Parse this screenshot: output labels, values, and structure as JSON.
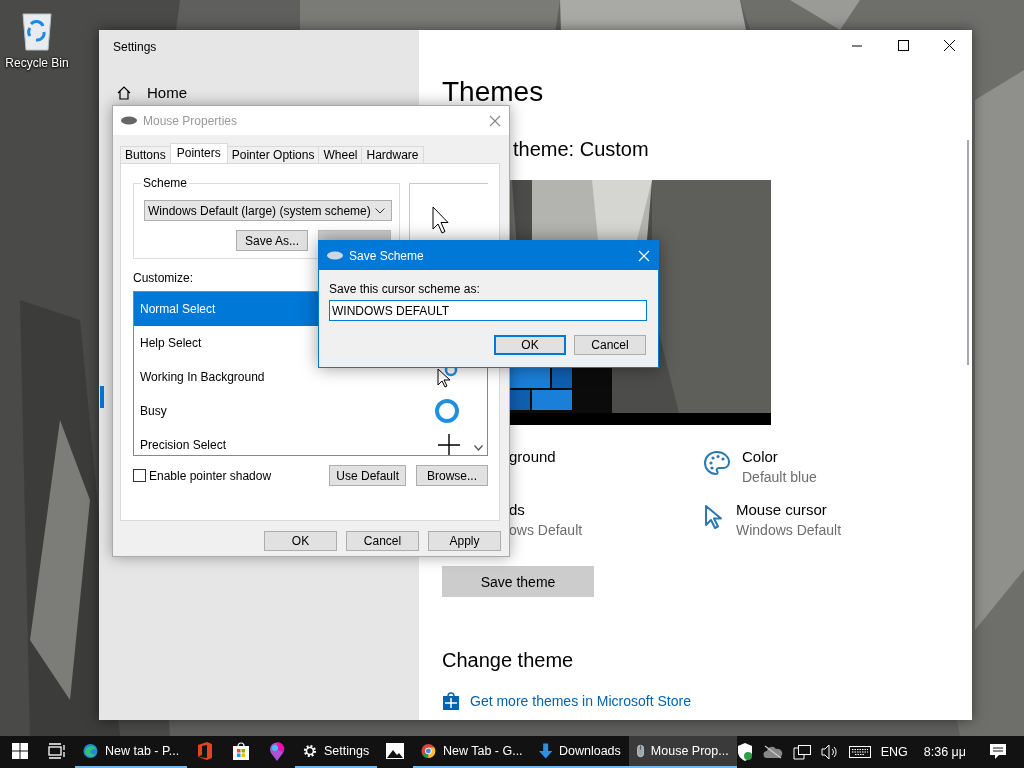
{
  "desktop": {
    "icons": [
      {
        "label": "Recycle Bin"
      }
    ]
  },
  "settings": {
    "title": "Settings",
    "nav": [
      {
        "label": "Home"
      }
    ],
    "heading": "Themes",
    "current_theme": "theme: Custom",
    "options": [
      {
        "title": "ground",
        "kind": "plain"
      },
      {
        "title": "Color",
        "subtitle": "Default blue",
        "kind": "palette"
      },
      {
        "title": "ds",
        "subtitle": "ows Default",
        "kind": "plain"
      },
      {
        "title": "Mouse cursor",
        "subtitle": "Windows Default",
        "kind": "cursor"
      }
    ],
    "save_button": "Save theme",
    "change_heading": "Change theme",
    "store_link": "Get more themes in Microsoft Store"
  },
  "mouse_properties": {
    "title": "Mouse Properties",
    "tabs": [
      {
        "label": "Buttons",
        "selected": false
      },
      {
        "label": "Pointers",
        "selected": true
      },
      {
        "label": "Pointer Options",
        "selected": false
      },
      {
        "label": "Wheel",
        "selected": false
      },
      {
        "label": "Hardware",
        "selected": false
      }
    ],
    "scheme_label": "Scheme",
    "scheme_value": "Windows Default (large) (system scheme)",
    "save_as_button": "Save As...",
    "delete_button": {
      "disabled": true
    },
    "customize_label": "Customize:",
    "pointers": [
      {
        "label": "Normal Select",
        "selected": true,
        "kind": "none"
      },
      {
        "label": "Help Select",
        "selected": false,
        "kind": "none"
      },
      {
        "label": "Working In Background",
        "selected": false,
        "kind": "busy_arrow"
      },
      {
        "label": "Busy",
        "selected": false,
        "kind": "busy"
      },
      {
        "label": "Precision Select",
        "selected": false,
        "kind": "cross"
      }
    ],
    "shadow": {
      "label": "Enable pointer shadow",
      "checked": false
    },
    "use_default_button": "Use Default",
    "browse_button": "Browse...",
    "buttons": [
      "OK",
      "Cancel",
      "Apply"
    ]
  },
  "save_scheme": {
    "title": "Save Scheme",
    "prompt": "Save this cursor scheme as:",
    "value": "WINDOWS DEFAULT",
    "buttons": [
      "OK",
      "Cancel"
    ]
  },
  "taskbar": {
    "items": [
      {
        "kind": "start",
        "running": false,
        "active": false
      },
      {
        "kind": "taskview",
        "running": false,
        "active": false
      },
      {
        "kind": "edge",
        "label": "New tab - P...",
        "running": true,
        "active": false
      },
      {
        "kind": "office",
        "running": false,
        "active": false
      },
      {
        "kind": "store",
        "running": false,
        "active": false
      },
      {
        "kind": "paint",
        "running": false,
        "active": false
      },
      {
        "kind": "gear",
        "label": "Settings",
        "running": true,
        "active": false
      },
      {
        "kind": "photos",
        "running": false,
        "active": false
      },
      {
        "kind": "chrome",
        "label": "New Tab - G...",
        "running": true,
        "active": false
      },
      {
        "kind": "download",
        "label": "Downloads",
        "running": true,
        "active": false
      },
      {
        "kind": "mouse",
        "label": "Mouse Prop...",
        "running": true,
        "active": true
      }
    ],
    "language": "ENG",
    "time": "8:36 μμ"
  }
}
